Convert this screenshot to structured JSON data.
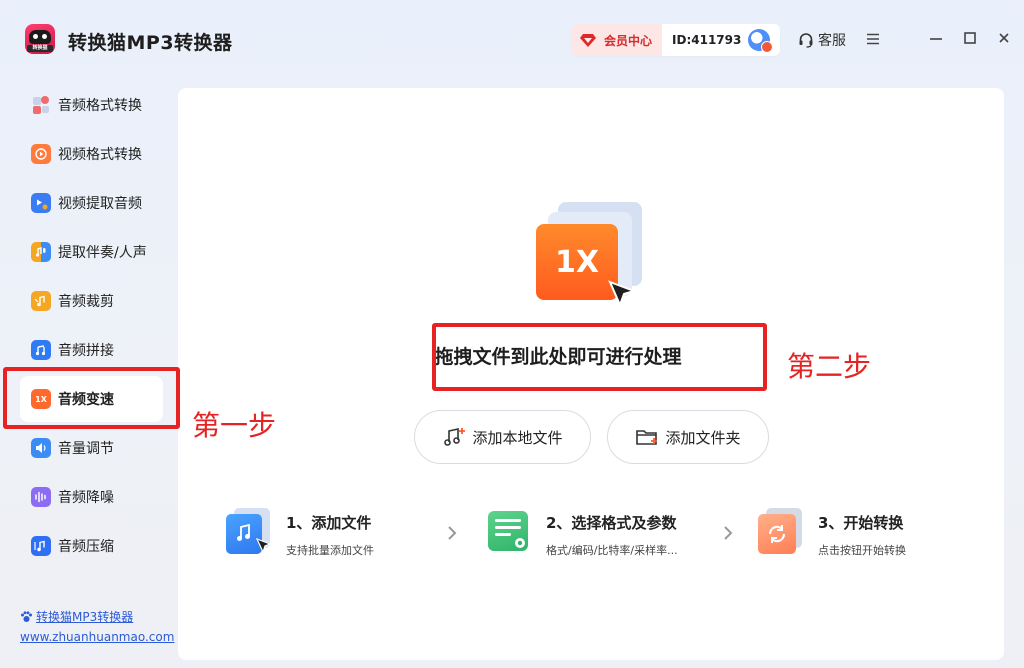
{
  "app": {
    "title": "转换猫MP3转换器",
    "logo_tag": "转换猫",
    "member_center": "会员中心",
    "user_id": "ID:411793",
    "service": "客服"
  },
  "sidebar": {
    "items": [
      {
        "label": "音频格式转换",
        "icon": "audio-format-icon",
        "color": "#f06b6b"
      },
      {
        "label": "视频格式转换",
        "icon": "video-format-icon",
        "color": "#ff7a3d"
      },
      {
        "label": "视频提取音频",
        "icon": "video-extract-audio-icon",
        "color": "#3c7cf2"
      },
      {
        "label": "提取伴奏/人声",
        "icon": "extract-vocal-icon",
        "color": "#f5a623"
      },
      {
        "label": "音频裁剪",
        "icon": "audio-cut-icon",
        "color": "#f5a623"
      },
      {
        "label": "音频拼接",
        "icon": "audio-join-icon",
        "color": "#2f7bf5"
      },
      {
        "label": "音频变速",
        "icon": "audio-speed-icon",
        "color": "#ff6a2c",
        "active": true,
        "badge": "1X"
      },
      {
        "label": "音量调节",
        "icon": "volume-icon",
        "color": "#3c8cf5"
      },
      {
        "label": "音频降噪",
        "icon": "denoise-icon",
        "color": "#7a5cf0"
      },
      {
        "label": "音频压缩",
        "icon": "audio-compress-icon",
        "color": "#2f6ff5"
      }
    ],
    "footer_name": "转换猫MP3转换器",
    "footer_url": "www.zhuanhuanmao.com"
  },
  "main": {
    "illustration_label": "1X",
    "drop_hint": "拖拽文件到此处即可进行处理",
    "add_file_button": "添加本地文件",
    "add_folder_button": "添加文件夹",
    "steps": [
      {
        "title": "1、添加文件",
        "desc": "支持批量添加文件"
      },
      {
        "title": "2、选择格式及参数",
        "desc": "格式/编码/比特率/采样率..."
      },
      {
        "title": "3、开始转换",
        "desc": "点击按钮开始转换"
      }
    ]
  },
  "annotations": {
    "step1": "第一步",
    "step2": "第二步",
    "color": "#e62222"
  },
  "colors": {
    "accent_orange": "#ff6a2c",
    "link_blue": "#2d5bd6",
    "member_red": "#d62c2c"
  }
}
